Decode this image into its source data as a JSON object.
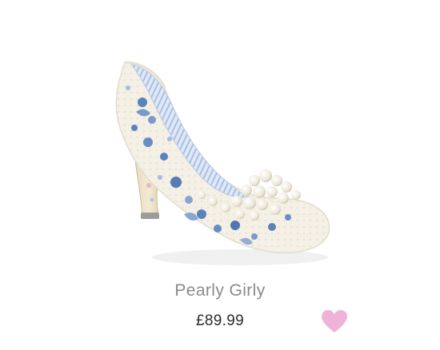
{
  "product": {
    "name": "Pearly Girly",
    "price": "£89.99"
  },
  "wishlist": {
    "icon": "heart-icon",
    "color": "#f0b3d8"
  },
  "image": {
    "icon": "shoe-image",
    "primary_color": "#f3efe6",
    "accent_color": "#4a78b8",
    "lining_color": "#c9d9ef"
  }
}
